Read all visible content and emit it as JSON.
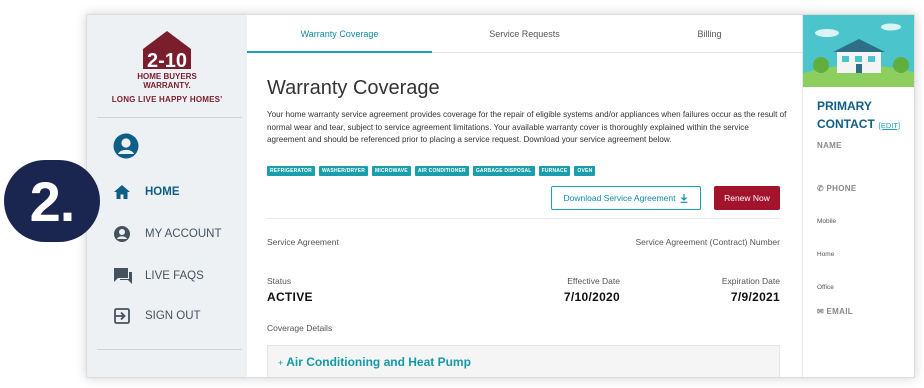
{
  "brand": {
    "logo_number": "2-10",
    "logo_line1": "HOME BUYERS",
    "logo_line2": "WARRANTY.",
    "tagline": "LONG LIVE HAPPY HOMES'",
    "colors": {
      "maroon": "#7a1d2c",
      "teal": "#1aa3b8",
      "navy": "#1b2650",
      "renew": "#a3132c"
    }
  },
  "sidebar": {
    "items": [
      {
        "label": "HOME",
        "icon": "home-icon",
        "active": true
      },
      {
        "label": "MY ACCOUNT",
        "icon": "account-icon",
        "active": false
      },
      {
        "label": "LIVE FAQS",
        "icon": "chat-icon",
        "active": false
      },
      {
        "label": "SIGN OUT",
        "icon": "sign-out-icon",
        "active": false
      }
    ]
  },
  "step_badge": "2.",
  "tabs": [
    {
      "label": "Warranty Coverage",
      "active": true
    },
    {
      "label": "Service Requests",
      "active": false
    },
    {
      "label": "Billing",
      "active": false
    }
  ],
  "main": {
    "title": "Warranty Coverage",
    "description": "Your home warranty service agreement provides coverage for the repair of eligible systems and/or appliances when failures occur as the result of normal wear and tear, subject to service agreement limitations. Your available warranty cover is thoroughly explained within the service agreement and should be referenced prior to placing a service request. Download your service agreement below.",
    "chips": [
      "REFRIGERATOR",
      "WASHER/DRYER",
      "MICROWAVE",
      "AIR CONDITIONER",
      "GARBAGE DISPOSAL",
      "FURNACE",
      "OVEN"
    ],
    "download_label": "Download Service Agreement",
    "renew_label": "Renew Now",
    "service_agreement_label": "Service Agreement",
    "contract_number_label": "Service Agreement (Contract) Number",
    "status_label": "Status",
    "status_value": "ACTIVE",
    "effective_label": "Effective Date",
    "effective_value": "7/10/2020",
    "expiration_label": "Expiration Date",
    "expiration_value": "7/9/2021",
    "coverage_details_label": "Coverage Details",
    "coverage_item": "Air Conditioning and Heat Pump"
  },
  "contact": {
    "title_line1": "PRIMARY",
    "title_line2": "CONTACT",
    "edit_label": "[EDIT]",
    "name_label": "NAME",
    "phone_label": "PHONE",
    "mobile_label": "Mobile",
    "home_label": "Home",
    "office_label": "Office",
    "email_label": "EMAIL"
  }
}
